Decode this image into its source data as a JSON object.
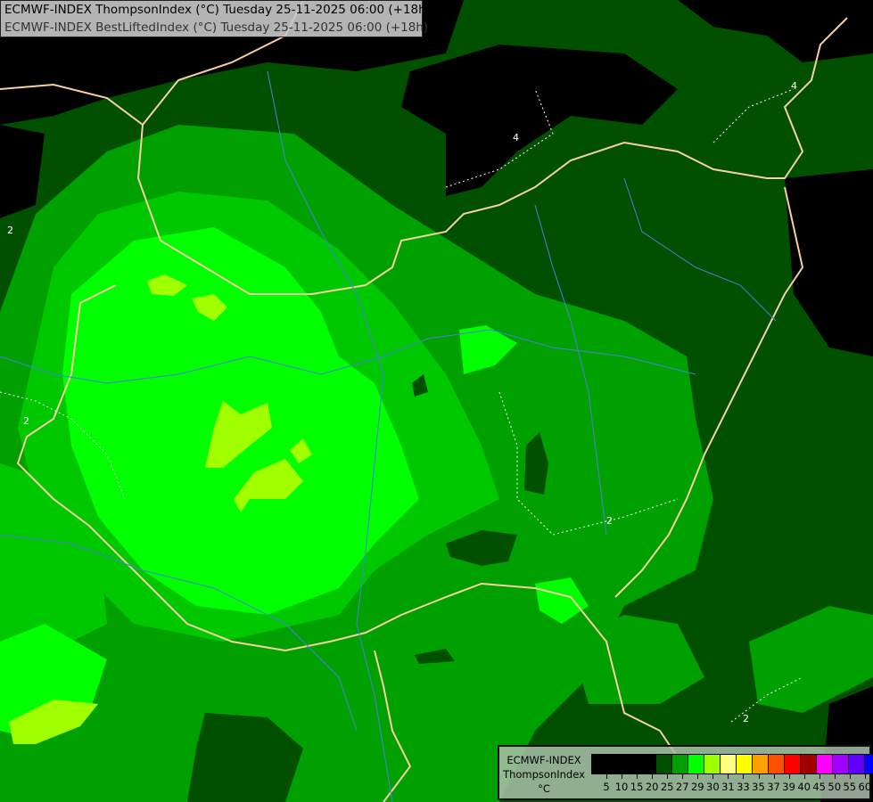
{
  "title": {
    "line1": "ECMWF-INDEX ThompsonIndex (°C) Tuesday 25-11-2025 06:00 (+18h)",
    "line2": "ECMWF-INDEX BestLiftedIndex (°C) Tuesday 25-11-2025 06:00 (+18h)"
  },
  "legend": {
    "line1": "ECMWF-INDEX",
    "line2": "ThompsonIndex",
    "unit": "°C",
    "colors": [
      "#000000",
      "#000000",
      "#000000",
      "#000000",
      "#005000",
      "#00a000",
      "#00ff00",
      "#a0ff00",
      "#ffff80",
      "#ffff00",
      "#ffa000",
      "#ff5000",
      "#ff0000",
      "#a00000",
      "#ff00ff",
      "#a000ff",
      "#6000ff",
      "#0000ff"
    ],
    "ticks": [
      "5",
      "10",
      "15",
      "20",
      "25",
      "27",
      "29",
      "30",
      "31",
      "33",
      "35",
      "37",
      "39",
      "40",
      "45",
      "50",
      "55",
      "60"
    ]
  },
  "contour_labels": [
    "2",
    "2",
    "2",
    "4",
    "4",
    "2"
  ]
}
